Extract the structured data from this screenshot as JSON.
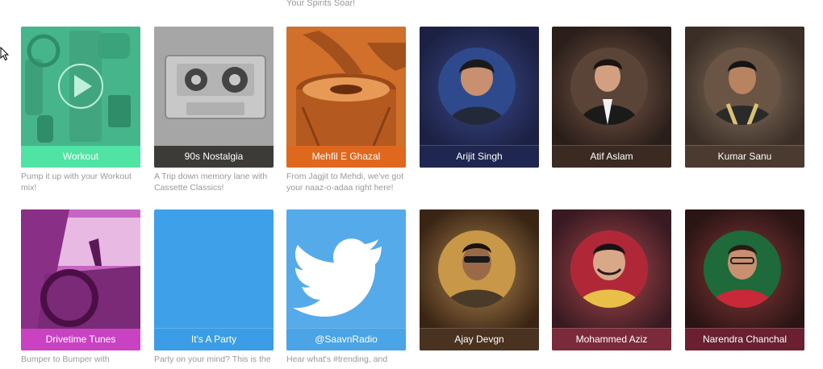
{
  "header": {
    "description_partial": "Your Spirits Soar!"
  },
  "rows": [
    [
      {
        "title": "Workout",
        "description": "Pump it up with your Workout mix!",
        "art": "headphones-play-icon",
        "label_color": "#4fe3a4"
      },
      {
        "title": "90s Nostalgia",
        "description": "A Trip down memory lane with Cassette Classics!",
        "art": "cassette-icon",
        "label_color": "#3d3b38"
      },
      {
        "title": "Mehfil E Ghazal",
        "description": "From Jagjit to Mehdi, we've got your naaz-o-adaa right here!",
        "art": "tabla-icon",
        "label_color": "#e0681e"
      },
      {
        "title": "Arijit Singh",
        "description": "",
        "art": "artist-portrait",
        "label_color": "#1f2750"
      },
      {
        "title": "Atif Aslam",
        "description": "",
        "art": "artist-portrait",
        "label_color": "#3a2a22"
      },
      {
        "title": "Kumar Sanu",
        "description": "",
        "art": "artist-portrait",
        "label_color": "#4a3a30"
      }
    ],
    [
      {
        "title": "Drivetime Tunes",
        "description": "Bumper to Bumper with",
        "art": "car-dashboard-icon",
        "label_color": "#c842c2"
      },
      {
        "title": "It's A Party",
        "description": "Party on your mind? This is the",
        "art": "blank",
        "label_color": "#3a9de5"
      },
      {
        "title": "@SaavnRadio",
        "description": "Hear what's #trending, and",
        "art": "twitter-bird-icon",
        "label_color": "#4aa4e6"
      },
      {
        "title": "Ajay Devgn",
        "description": "",
        "art": "artist-portrait",
        "label_color": "#4a3220"
      },
      {
        "title": "Mohammed Aziz",
        "description": "",
        "art": "artist-portrait",
        "label_color": "#7a2a3a"
      },
      {
        "title": "Narendra Chanchal",
        "description": "",
        "art": "artist-portrait",
        "label_color": "#6a2030"
      }
    ]
  ]
}
